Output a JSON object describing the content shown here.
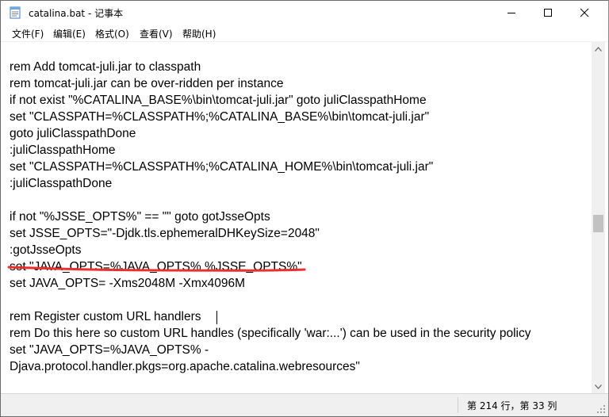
{
  "window": {
    "title": "catalina.bat - 记事本",
    "minimize_glyph": "–",
    "maximize_glyph": "☐",
    "close_glyph": "✕"
  },
  "menu": {
    "items": [
      {
        "label": "文件(F)"
      },
      {
        "label": "编辑(E)"
      },
      {
        "label": "格式(O)"
      },
      {
        "label": "查看(V)"
      },
      {
        "label": "帮助(H)"
      }
    ]
  },
  "editor": {
    "lines": [
      "rem Add tomcat-juli.jar to classpath",
      "rem tomcat-juli.jar can be over-ridden per instance",
      "if not exist \"%CATALINA_BASE%\\bin\\tomcat-juli.jar\" goto juliClasspathHome",
      "set \"CLASSPATH=%CLASSPATH%;%CATALINA_BASE%\\bin\\tomcat-juli.jar\"",
      "goto juliClasspathDone",
      ":juliClasspathHome",
      "set \"CLASSPATH=%CLASSPATH%;%CATALINA_HOME%\\bin\\tomcat-juli.jar\"",
      ":juliClasspathDone",
      "",
      "if not \"%JSSE_OPTS%\" == \"\" goto gotJsseOpts",
      "set JSSE_OPTS=\"-Djdk.tls.ephemeralDHKeySize=2048\"",
      ":gotJsseOpts",
      "set \"JAVA_OPTS=%JAVA_OPTS% %JSSE_OPTS%\"",
      "set JAVA_OPTS= -Xms2048M -Xmx4096M",
      "",
      "rem Register custom URL handlers",
      "rem Do this here so custom URL handles (specifically 'war:...') can be used in the security policy",
      "set \"JAVA_OPTS=%JAVA_OPTS% -",
      "Djava.protocol.handler.pkgs=org.apache.catalina.webresources\""
    ]
  },
  "scrollbar": {
    "position_fraction": 0.52
  },
  "status": {
    "position": "第 214 行，第 33 列"
  },
  "colors": {
    "annotation_red": "#e8312f",
    "text": "#000000",
    "chrome_bg": "#f0f0f0"
  }
}
